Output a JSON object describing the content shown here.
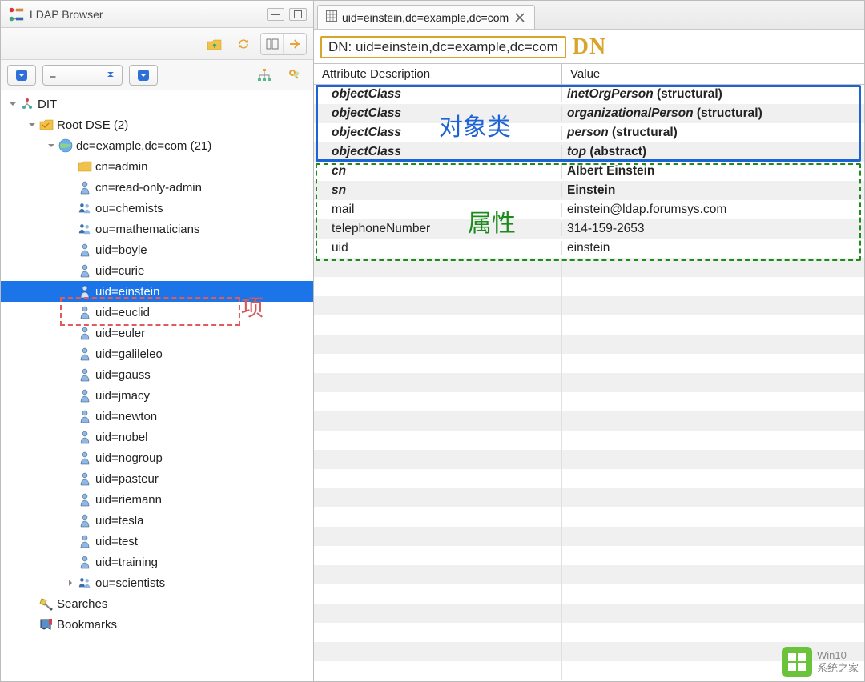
{
  "left": {
    "title": "LDAP Browser",
    "filter_op": "=",
    "tree": {
      "root_label": "DIT",
      "items": [
        {
          "label": "Root DSE (2)",
          "icon": "folder",
          "depth": 1,
          "expanded": true
        },
        {
          "label": "dc=example,dc=com (21)",
          "icon": "globe",
          "depth": 2,
          "expanded": true
        },
        {
          "label": "cn=admin",
          "icon": "folder-small",
          "depth": 3
        },
        {
          "label": "cn=read-only-admin",
          "icon": "person",
          "depth": 3
        },
        {
          "label": "ou=chemists",
          "icon": "group",
          "depth": 3
        },
        {
          "label": "ou=mathematicians",
          "icon": "group",
          "depth": 3
        },
        {
          "label": "uid=boyle",
          "icon": "person",
          "depth": 3
        },
        {
          "label": "uid=curie",
          "icon": "person",
          "depth": 3
        },
        {
          "label": "uid=einstein",
          "icon": "person",
          "depth": 3,
          "selected": true
        },
        {
          "label": "uid=euclid",
          "icon": "person",
          "depth": 3
        },
        {
          "label": "uid=euler",
          "icon": "person",
          "depth": 3
        },
        {
          "label": "uid=galileleo",
          "icon": "person",
          "depth": 3
        },
        {
          "label": "uid=gauss",
          "icon": "person",
          "depth": 3
        },
        {
          "label": "uid=jmacy",
          "icon": "person",
          "depth": 3
        },
        {
          "label": "uid=newton",
          "icon": "person",
          "depth": 3
        },
        {
          "label": "uid=nobel",
          "icon": "person",
          "depth": 3
        },
        {
          "label": "uid=nogroup",
          "icon": "person",
          "depth": 3
        },
        {
          "label": "uid=pasteur",
          "icon": "person",
          "depth": 3
        },
        {
          "label": "uid=riemann",
          "icon": "person",
          "depth": 3
        },
        {
          "label": "uid=tesla",
          "icon": "person",
          "depth": 3
        },
        {
          "label": "uid=test",
          "icon": "person",
          "depth": 3
        },
        {
          "label": "uid=training",
          "icon": "person",
          "depth": 3
        },
        {
          "label": "ou=scientists",
          "icon": "group",
          "depth": 3,
          "collapsed_child": true
        }
      ],
      "searches_label": "Searches",
      "bookmarks_label": "Bookmarks"
    }
  },
  "right": {
    "tab_title": "uid=einstein,dc=example,dc=com",
    "dn_prefix": "DN: ",
    "dn_value": "uid=einstein,dc=example,dc=com",
    "headers": {
      "attr": "Attribute Description",
      "val": "Value"
    },
    "rows": [
      {
        "attr": "objectClass",
        "val": "inetOrgPerson",
        "val_suffix": " (structural)",
        "bold": true
      },
      {
        "attr": "objectClass",
        "val": "organizationalPerson",
        "val_suffix": " (structural)",
        "bold": true
      },
      {
        "attr": "objectClass",
        "val": "person",
        "val_suffix": " (structural)",
        "bold": true
      },
      {
        "attr": "objectClass",
        "val": "top",
        "val_suffix": " (abstract)",
        "bold": true
      },
      {
        "attr": "cn",
        "val": "Albert Einstein",
        "bold_attr": true,
        "bold_val": true
      },
      {
        "attr": "sn",
        "val": "Einstein",
        "bold_attr": true,
        "bold_val": true
      },
      {
        "attr": "mail",
        "val": "einstein@ldap.forumsys.com"
      },
      {
        "attr": "telephoneNumber",
        "val": "314-159-2653"
      },
      {
        "attr": "uid",
        "val": "einstein"
      }
    ]
  },
  "annotations": {
    "entry_label": "项",
    "dn_label": "DN",
    "objectclass_label": "对象类",
    "attributes_label": "属性"
  },
  "watermark": {
    "line1": "Win10",
    "line2": "系统之家"
  }
}
